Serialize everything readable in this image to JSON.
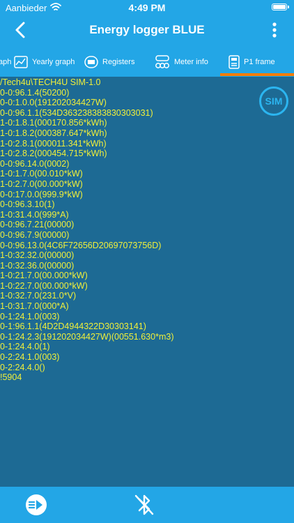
{
  "status_bar": {
    "carrier": "Aanbieder",
    "time": "4:49 PM"
  },
  "header": {
    "title": "Energy logger BLUE",
    "back_icon": "chevron-left-icon",
    "menu_icon": "more-vertical-icon"
  },
  "tabs": [
    {
      "label": "aph",
      "icon": ""
    },
    {
      "label": "Yearly graph",
      "icon": "yearly-graph-icon"
    },
    {
      "label": "Registers",
      "icon": "registers-icon"
    },
    {
      "label": "Meter info",
      "icon": "meter-info-icon"
    },
    {
      "label": "P1 frame",
      "icon": "p1-frame-icon",
      "active": true
    }
  ],
  "frame": {
    "lines": [
      "/Tech4u\\TECH4U SIM-1.0",
      "0-0:96.1.4(50200)",
      "0-0:1.0.0(191202034427W)",
      "0-0:96.1.1(534D363238383830303031)",
      "1-0:1.8.1(000170.856*kWh)",
      "1-0:1.8.2(000387.647*kWh)",
      "1-0:2.8.1(000011.341*kWh)",
      "1-0:2.8.2(000454.715*kWh)",
      "0-0:96.14.0(0002)",
      "1-0:1.7.0(00.010*kW)",
      "1-0:2.7.0(00.000*kW)",
      "0-0:17.0.0(999.9*kW)",
      "0-0:96.3.10(1)",
      "1-0:31.4.0(999*A)",
      "0-0:96.7.21(00000)",
      "0-0:96.7.9(00000)",
      "0-0:96.13.0(4C6F72656D20697073756D)",
      "1-0:32.32.0(00000)",
      "1-0:32.36.0(00000)",
      "1-0:21.7.0(00.000*kW)",
      "1-0:22.7.0(00.000*kW)",
      "1-0:32.7.0(231.0*V)",
      "1-0:31.7.0(000*A)",
      "0-1:24.1.0(003)",
      "0-1:96.1.1(4D2D4944322D30303141)",
      "0-1:24.2.3(191202034427W)(00551.630*m3)",
      "0-1:24.4.0(1)",
      "0-2:24.1.0(003)",
      "0-2:24.4.0()",
      "!5904"
    ],
    "badge_label": "SIM"
  },
  "bottom_bar": {
    "send_icon": "send-arrow-icon",
    "bluetooth_icon": "bluetooth-disabled-icon"
  },
  "colors": {
    "bar": "#23a6e6",
    "background": "#1d6a94",
    "frame_text": "#f0ef3a",
    "tab_underline": "#f57c00",
    "badge": "#2bb5f0"
  }
}
